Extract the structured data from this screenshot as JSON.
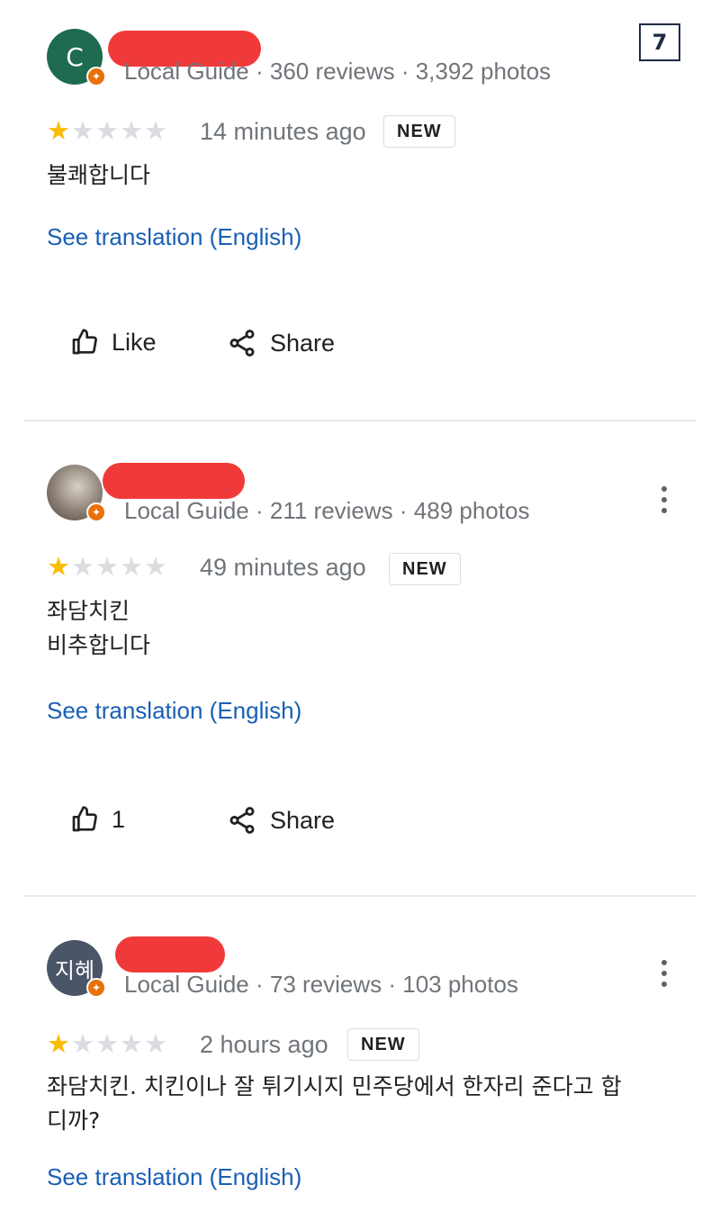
{
  "page_number": "7",
  "reviews": [
    {
      "avatar_letter": "C",
      "avatar_color": "#1e6b4f",
      "meta": "Local Guide · 360 reviews · 3,392 photos",
      "rating": 1,
      "max_rating": 5,
      "time": "14 minutes ago",
      "badge": "NEW",
      "text_lines": [
        "불쾌합니다"
      ],
      "translate_link": "See translation (English)",
      "like_label": "Like",
      "share_label": "Share"
    },
    {
      "avatar_letter": "",
      "avatar_color": "#8a7f76",
      "meta": "Local Guide · 211 reviews · 489 photos",
      "rating": 1,
      "max_rating": 5,
      "time": "49 minutes ago",
      "badge": "NEW",
      "text_lines": [
        "좌담치킨",
        "비추합니다"
      ],
      "translate_link": "See translation (English)",
      "like_label": "1",
      "share_label": "Share"
    },
    {
      "avatar_letter": "지혜",
      "avatar_color": "#4a5568",
      "meta": "Local Guide · 73 reviews · 103 photos",
      "rating": 1,
      "max_rating": 5,
      "time": "2 hours ago",
      "badge": "NEW",
      "text_lines": [
        "좌담치킨. 치킨이나 잘 튀기시지 민주당에서 한자리 준다고 합",
        "디까?"
      ],
      "translate_link": "See translation (English)"
    }
  ],
  "colors": {
    "star_filled": "#fbbc04",
    "star_empty": "#dadce0",
    "link": "#1a5fb4",
    "redaction": "#f03a3a",
    "guide_badge": "#e8710a"
  },
  "icons": {
    "like": "thumbs-up-icon",
    "share": "share-icon",
    "more": "more-vertical-icon",
    "guide": "local-guide-badge-icon"
  }
}
